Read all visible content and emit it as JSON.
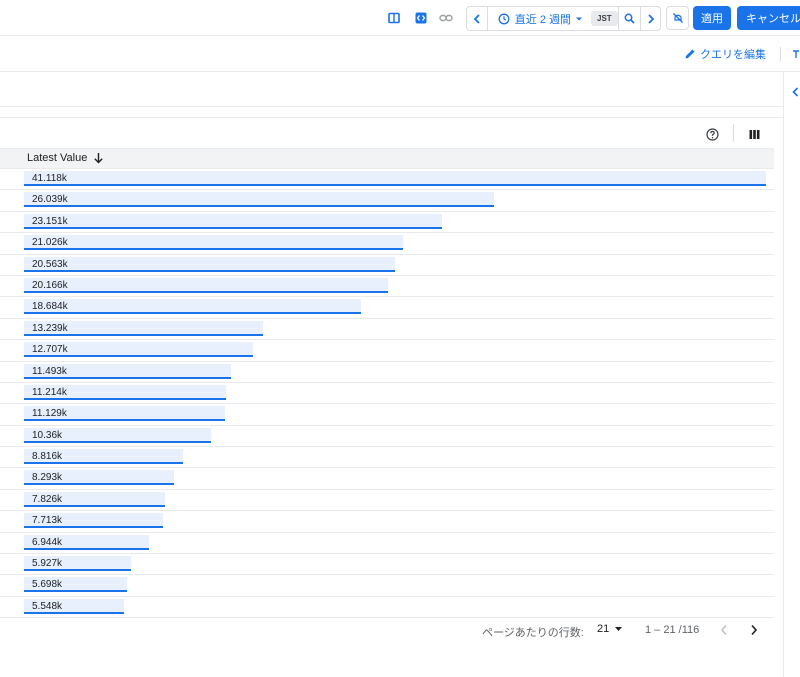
{
  "toolbar": {
    "time_range": "直近 2 週間",
    "timezone": "JST",
    "apply_label": "適用",
    "cancel_label": "キャンセル"
  },
  "query_bar": {
    "edit_query_label": "クエリを編集"
  },
  "table": {
    "column_header": "Latest Value",
    "max_value": 41118,
    "rows": [
      {
        "label": "41.118k",
        "value": 41118
      },
      {
        "label": "26.039k",
        "value": 26039
      },
      {
        "label": "23.151k",
        "value": 23151
      },
      {
        "label": "21.026k",
        "value": 21026
      },
      {
        "label": "20.563k",
        "value": 20563
      },
      {
        "label": "20.166k",
        "value": 20166
      },
      {
        "label": "18.684k",
        "value": 18684
      },
      {
        "label": "13.239k",
        "value": 13239
      },
      {
        "label": "12.707k",
        "value": 12707
      },
      {
        "label": "11.493k",
        "value": 11493
      },
      {
        "label": "11.214k",
        "value": 11214
      },
      {
        "label": "11.129k",
        "value": 11129
      },
      {
        "label": "10.36k",
        "value": 10360
      },
      {
        "label": "8.816k",
        "value": 8816
      },
      {
        "label": "8.293k",
        "value": 8293
      },
      {
        "label": "7.826k",
        "value": 7826
      },
      {
        "label": "7.713k",
        "value": 7713
      },
      {
        "label": "6.944k",
        "value": 6944
      },
      {
        "label": "5.927k",
        "value": 5927
      },
      {
        "label": "5.698k",
        "value": 5698
      },
      {
        "label": "5.548k",
        "value": 5548
      }
    ]
  },
  "pagination": {
    "rows_per_page_label": "ページあたりの行数:",
    "rows_per_page": "21",
    "range_text": "1 – 21 /116"
  },
  "colors": {
    "accent": "#1a73e8",
    "bar_fill": "#e8f0fe",
    "header_bg": "#f1f3f4"
  }
}
